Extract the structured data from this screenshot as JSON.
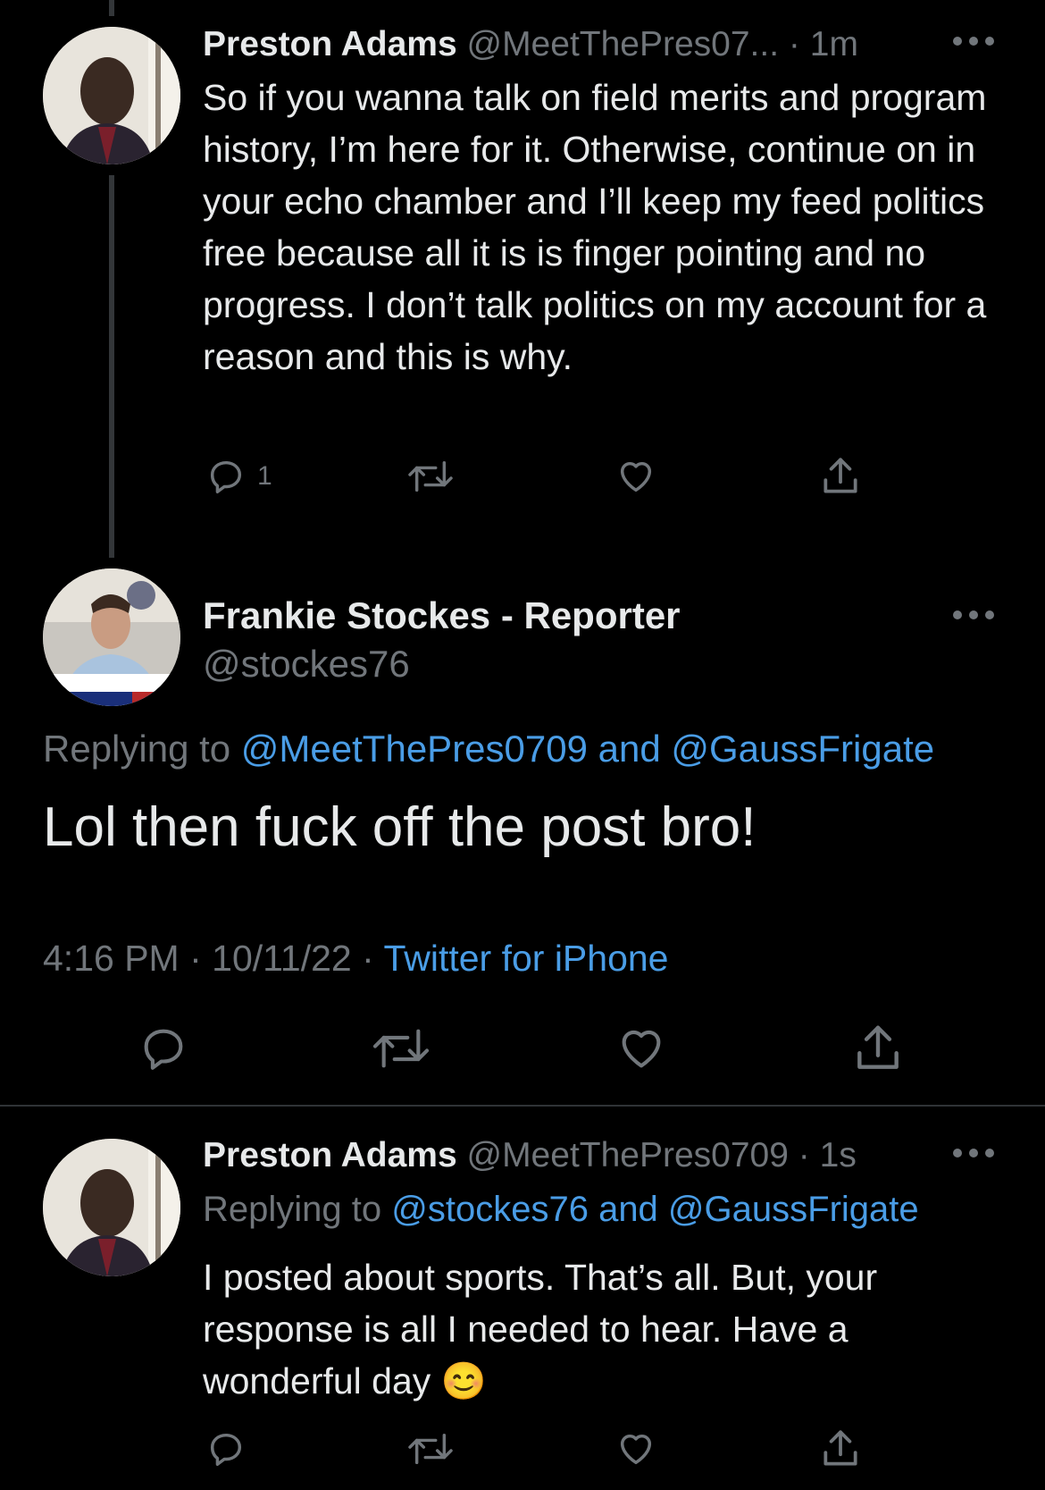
{
  "tweet1": {
    "name": "Preston Adams",
    "handle": "@MeetThePres07...",
    "sep": "·",
    "time": "1m",
    "text": "So if you wanna talk on field merits and program history, I’m here for it. Otherwise, continue on in your echo chamber and I’ll keep my feed politics free because all it is is finger pointing and no progress. I don’t talk politics on my account for a reason and this is why.",
    "reply_count": "1"
  },
  "tweet2": {
    "name": "Frankie Stockes - Reporter",
    "handle": "@stockes76",
    "replying_prefix": "Replying to",
    "replying_users": "@MeetThePres0709 and @GaussFrigate",
    "text": "Lol then fuck off the post bro!",
    "time": "4:16 PM",
    "date": "10/11/22",
    "source": "Twitter for iPhone",
    "sep": "·"
  },
  "tweet3": {
    "name": "Preston Adams",
    "handle": "@MeetThePres0709",
    "sep": "·",
    "time": "1s",
    "replying_prefix": "Replying to",
    "replying_users": "@stockes76 and @GaussFrigate",
    "text": "I posted about sports. That’s all. But, your response is all I needed to hear. Have a wonderful day",
    "emoji": "😊"
  },
  "icons": {
    "reply": "reply-icon",
    "retweet": "retweet-icon",
    "like": "like-icon",
    "share": "share-icon",
    "more": "more-icon"
  },
  "colors": {
    "background": "#000000",
    "text": "#e7e9ea",
    "muted": "#71767b",
    "link": "#4a9de6",
    "divider": "#2f3336"
  }
}
